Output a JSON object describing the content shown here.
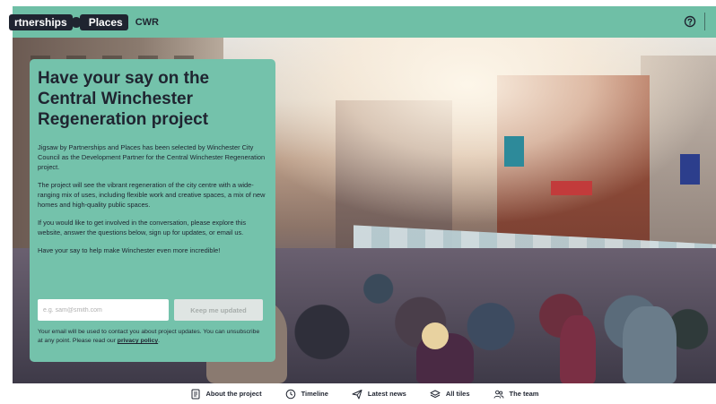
{
  "header": {
    "logo_left": "rtnerships",
    "logo_right": "Places",
    "project_code": "CWR",
    "help_icon": "help-circle-icon"
  },
  "card": {
    "title": "Have your say on the Central Winchester Regeneration project",
    "paragraphs": [
      "Jigsaw by Partnerships and Places has been selected by Winchester City Council as the Development Partner for the Central Winchester Regeneration project.",
      "The project will see the vibrant regeneration of the city centre with a wide-ranging mix of uses, including flexible work and creative spaces, a mix of new homes and high-quality public spaces.",
      " If you would like to get involved in the conversation, please explore this website, answer the questions below, sign up for updates, or email us.",
      "Have your say to help make Winchester even more incredible!"
    ],
    "email_placeholder": "e.g. sam@smith.com",
    "submit_label": "Keep me updated",
    "notice_text": "Your email will be used to contact you about project updates. You can unsubscribe at any point. Please read our ",
    "notice_link": "privacy policy",
    "notice_end": "."
  },
  "bottom_nav": {
    "items": [
      {
        "label": "About the project",
        "icon": "document-icon"
      },
      {
        "label": "Timeline",
        "icon": "clock-icon"
      },
      {
        "label": "Latest news",
        "icon": "paper-plane-icon"
      },
      {
        "label": "All tiles",
        "icon": "layers-icon"
      },
      {
        "label": "The team",
        "icon": "people-icon"
      }
    ]
  },
  "colors": {
    "brand_green": "#6fbfa6",
    "card_green": "#74c2ab",
    "dark": "#1f2430"
  }
}
